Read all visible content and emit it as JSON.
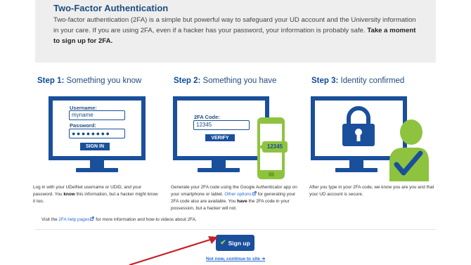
{
  "intro": {
    "title": "Two-Factor Authentication",
    "text": "Two-factor authentication (2FA) is a simple but powerful way to safeguard your UD account and the University information in your care. If you are using 2FA, even if a hacker has your password, your information is probably safe.",
    "cta_bold": "Take a moment to sign up for 2FA."
  },
  "steps": [
    {
      "label": "Step 1:",
      "title": "Something you know",
      "illustration": {
        "username_label": "Username:",
        "username_value": "myname",
        "password_label": "Password:",
        "password_value": "●●●●●●●●",
        "button": "SIGN IN"
      },
      "desc_1": "Log in with your UDelNet username or UDID, and your password. You",
      "desc_bold": "know",
      "desc_2": "this information, but a hacker might know it too."
    },
    {
      "label": "Step 2:",
      "title": "Something you have",
      "illustration": {
        "code_label": "2FA Code:",
        "code_value": "12345",
        "button": "VERIFY",
        "phone_code": "12345"
      },
      "desc_1": "Generate your 2FA code using the Google Authenticator app on your smartphone or tablet.",
      "desc_link": "Other options",
      "desc_2": "for generating your 2FA code also are available. You",
      "desc_bold": "have",
      "desc_3": "the 2FA code in your possession, but a hacker will not."
    },
    {
      "label": "Step 3:",
      "title": "Identity confirmed",
      "desc": "After you type in your 2FA code, we know you are you and that your UD account is secure."
    }
  ],
  "help": {
    "prefix": "Visit the",
    "link": "2FA help pages",
    "suffix": "for more information and how-to videos about 2FA."
  },
  "actions": {
    "signup": "Sign up",
    "not_now": "Not now, continue to site ➜"
  },
  "colors": {
    "brand_blue": "#1a4f9c",
    "accent_green": "#8ec33f",
    "link_blue": "#2a6ad1",
    "arrow_red": "#c62026"
  }
}
